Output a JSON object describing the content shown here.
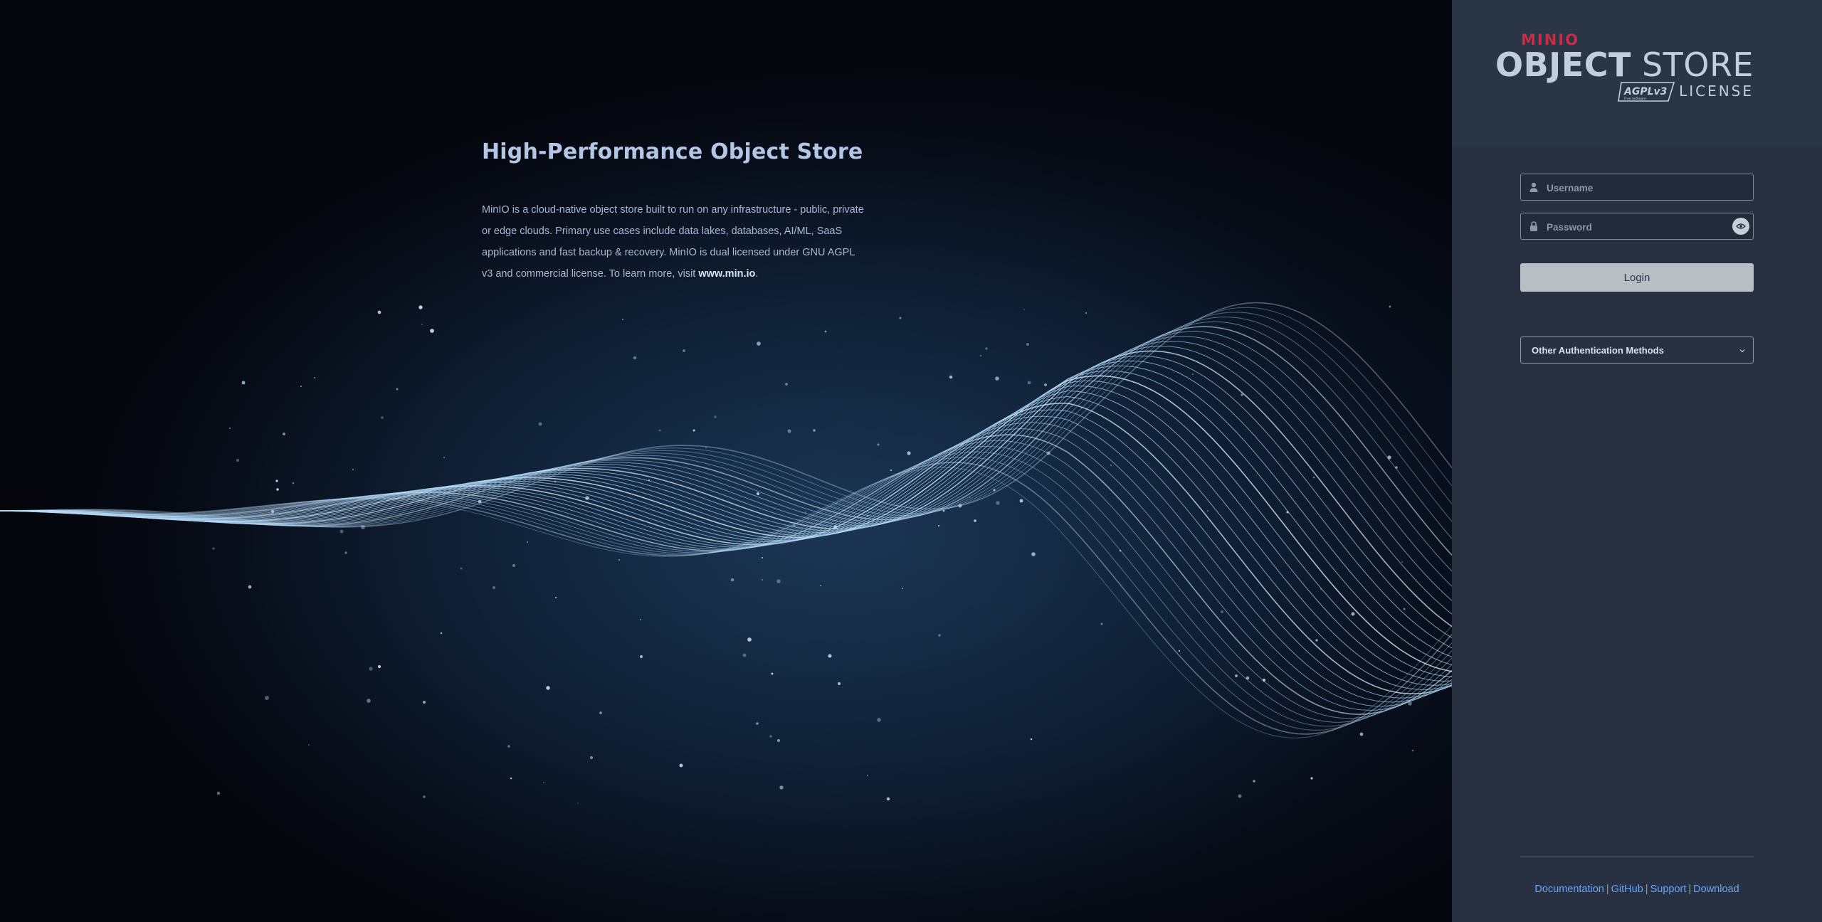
{
  "hero": {
    "title": "High-Performance Object Store",
    "description_text": "MinIO is a cloud-native object store built to run on any infrastructure - public, private or edge clouds. Primary use cases include data lakes, databases, AI/ML, SaaS applications and fast backup & recovery. MinIO is dual licensed under GNU AGPL v3 and commercial license. To learn more, visit ",
    "link_text": "www.min.io",
    "trailing": "."
  },
  "logo": {
    "brand": "MINIO",
    "product_bold": "OBJECT",
    "product_light": "STORE",
    "badge": "AGPLv3",
    "badge_sub": "Free Software",
    "license": "LICENSE"
  },
  "login": {
    "username_placeholder": "Username",
    "password_placeholder": "Password",
    "login_button": "Login",
    "other_auth": "Other Authentication Methods"
  },
  "footer": {
    "links": [
      "Documentation",
      "GitHub",
      "Support",
      "Download"
    ],
    "separator": "|"
  },
  "icons": {
    "user": "user-icon",
    "lock": "lock-icon",
    "eye": "eye-icon",
    "chevron": "chevron-down-icon"
  },
  "colors": {
    "brand_red": "#c72c48",
    "panel_bg": "#273142",
    "link": "#6aa6f7",
    "login_button_bg": "#b9bec4"
  }
}
